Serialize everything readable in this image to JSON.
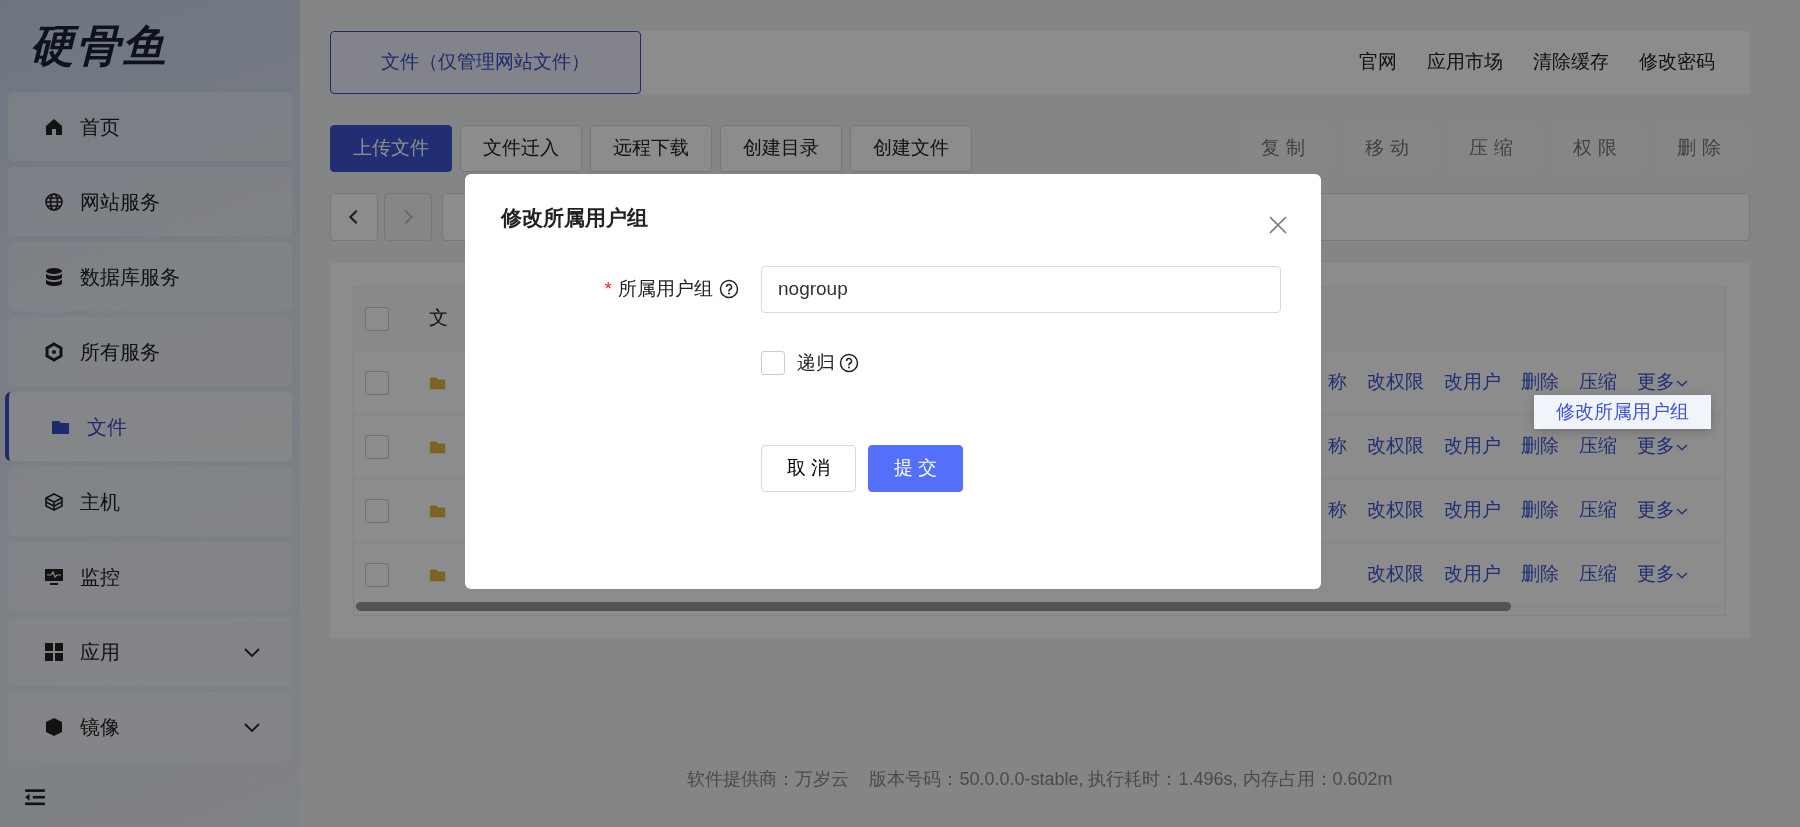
{
  "logo": {
    "text": "硬骨鱼"
  },
  "sidebar": {
    "items": [
      {
        "label": "首页",
        "selected": false,
        "expandable": false
      },
      {
        "label": "网站服务",
        "selected": false,
        "expandable": false
      },
      {
        "label": "数据库服务",
        "selected": false,
        "expandable": false
      },
      {
        "label": "所有服务",
        "selected": false,
        "expandable": false
      },
      {
        "label": "文件",
        "selected": true,
        "expandable": false
      },
      {
        "label": "主机",
        "selected": false,
        "expandable": false
      },
      {
        "label": "监控",
        "selected": false,
        "expandable": false
      },
      {
        "label": "应用",
        "selected": false,
        "expandable": true
      },
      {
        "label": "镜像",
        "selected": false,
        "expandable": true
      }
    ]
  },
  "header": {
    "tabs": [
      {
        "label": "文件（仅管理网站文件）",
        "selected": true
      }
    ],
    "links": [
      "官网",
      "应用市场",
      "清除缓存",
      "修改密码"
    ]
  },
  "toolbar": {
    "left": [
      {
        "label": "上传文件",
        "kind": "primary",
        "disabled": false
      },
      {
        "label": "文件迁入",
        "kind": "default",
        "disabled": false
      },
      {
        "label": "远程下载",
        "kind": "default",
        "disabled": false
      },
      {
        "label": "创建目录",
        "kind": "default",
        "disabled": false
      },
      {
        "label": "创建文件",
        "kind": "default",
        "disabled": false
      }
    ],
    "right": [
      {
        "label": "复制",
        "kind": "default",
        "disabled": true
      },
      {
        "label": "移动",
        "kind": "default",
        "disabled": true
      },
      {
        "label": "压缩",
        "kind": "default",
        "disabled": true
      },
      {
        "label": "权限",
        "kind": "default",
        "disabled": true
      },
      {
        "label": "删除",
        "kind": "default",
        "disabled": true
      }
    ]
  },
  "navigation": {
    "back_disabled": false,
    "forward_disabled": true
  },
  "table": {
    "select_all_checked": false,
    "columns": [
      {
        "label": "文"
      }
    ],
    "rows": [
      {
        "checked": false,
        "actions": [
          "称",
          "改权限",
          "改用户",
          "删除",
          "压缩",
          "更多"
        ]
      },
      {
        "checked": false,
        "actions": [
          "称",
          "改权限",
          "改用户",
          "删除",
          "压缩",
          "更多"
        ]
      },
      {
        "checked": false,
        "actions": [
          "称",
          "改权限",
          "改用户",
          "删除",
          "压缩",
          "更多"
        ]
      },
      {
        "checked": false,
        "actions": [
          "改权限",
          "改用户",
          "删除",
          "压缩",
          "更多"
        ]
      }
    ]
  },
  "dropdown": {
    "items": [
      "修改所属用户组"
    ]
  },
  "modal": {
    "title": "修改所属用户组",
    "field": {
      "required_mark": "*",
      "label": "所属用户组",
      "value": "nogroup"
    },
    "checkbox": {
      "label": "递归",
      "checked": false
    },
    "buttons": [
      {
        "label": "取 消",
        "kind": "default"
      },
      {
        "label": "提 交",
        "kind": "primary"
      }
    ]
  },
  "footer": {
    "text": "软件提供商：万岁云    版本号码：50.0.0.0-stable, 执行耗时：1.496s, 内存占用：0.602m"
  }
}
